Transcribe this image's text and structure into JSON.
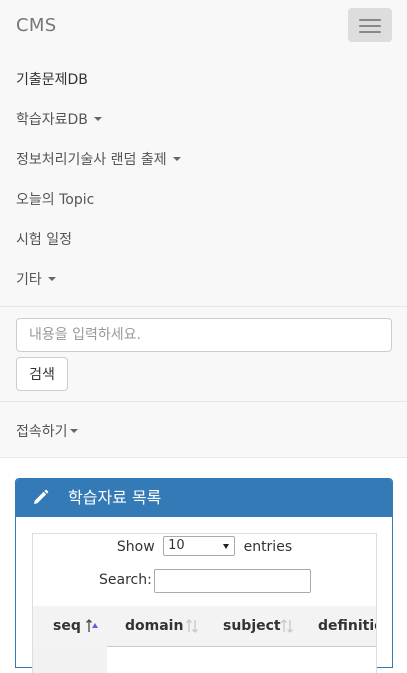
{
  "navbar": {
    "brand": "CMS",
    "items": [
      {
        "label": "기출문제DB",
        "has_caret": false
      },
      {
        "label": "학습자료DB",
        "has_caret": true
      },
      {
        "label": "정보처리기술사 랜덤 출제",
        "has_caret": true
      },
      {
        "label": "오늘의 Topic",
        "has_caret": false
      },
      {
        "label": "시험 일정",
        "has_caret": false
      },
      {
        "label": "기타",
        "has_caret": true
      }
    ],
    "search_placeholder": "내용을 입력하세요.",
    "search_button": "검색",
    "connect_label": "접속하기"
  },
  "panel": {
    "title": "학습자료 목록",
    "icon": "pencil-icon",
    "color": "#337ab7"
  },
  "datatable": {
    "show_label": "Show",
    "length_value": "10",
    "entries_label": "entries",
    "search_label": "Search:",
    "columns": [
      "seq",
      "domain",
      "subject",
      "definition"
    ],
    "sorted_column": "seq",
    "sort_direction": "asc"
  }
}
